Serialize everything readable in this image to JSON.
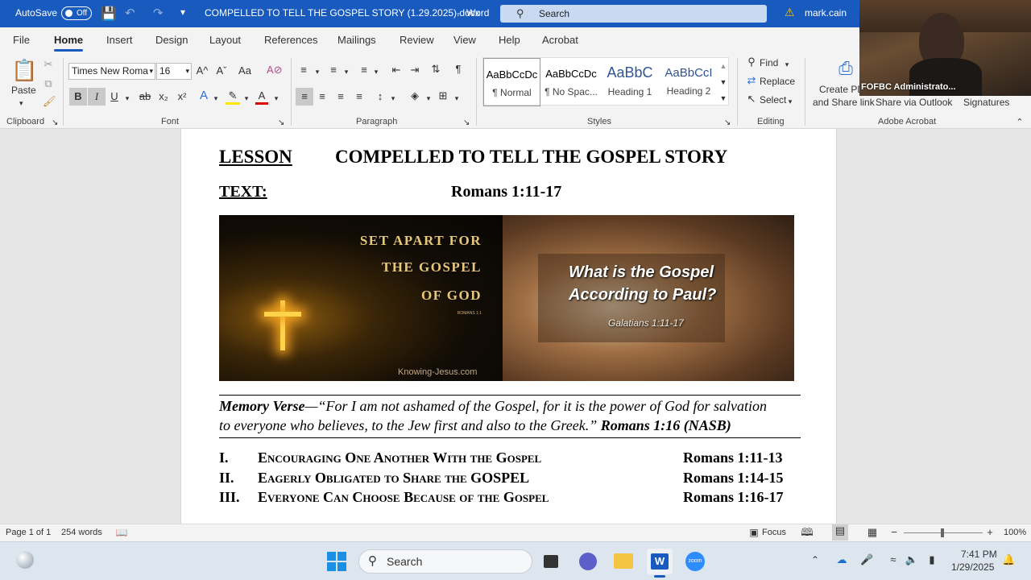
{
  "titlebar": {
    "autosave_label": "AutoSave",
    "autosave_state": "Off",
    "doc_title": "COMPELLED TO TELL THE GOSPEL STORY (1.29.2025).docx",
    "app_sep": "-",
    "app_name": "Word",
    "search_placeholder": "Search",
    "user": "mark.cain"
  },
  "menu": [
    "File",
    "Home",
    "Insert",
    "Design",
    "Layout",
    "References",
    "Mailings",
    "Review",
    "View",
    "Help",
    "Acrobat"
  ],
  "ribbon": {
    "clipboard": {
      "paste": "Paste",
      "label": "Clipboard"
    },
    "font": {
      "name": "Times New Roma",
      "size": "16",
      "label": "Font",
      "grow": "A^",
      "shrink": "Aˇ",
      "case": "Aa",
      "bold": "B",
      "italic": "I",
      "underline": "U",
      "strike": "ab",
      "sub": "x₂",
      "sup": "x²",
      "effects": "A",
      "highlight": "✎",
      "color": "A"
    },
    "paragraph": {
      "label": "Paragraph"
    },
    "styles": {
      "label": "Styles",
      "items": [
        {
          "sample": "AaBbCcDc",
          "name": "¶ Normal"
        },
        {
          "sample": "AaBbCcDc",
          "name": "¶ No Spac..."
        },
        {
          "sample": "AaBbC",
          "name": "Heading 1"
        },
        {
          "sample": "AaBbCcI",
          "name": "Heading 2"
        }
      ]
    },
    "editing": {
      "find": "Find",
      "replace": "Replace",
      "select": "Select",
      "label": "Editing"
    },
    "acrobat": {
      "create_line1": "Create PD",
      "create_line2": "and Share link",
      "share": "Share via Outlook",
      "signatures": "Signatures",
      "label": "Adobe Acrobat"
    }
  },
  "video": {
    "name": "FOFBC Administrato..."
  },
  "doc": {
    "lesson_label": "LESSON",
    "lesson_title": "COMPELLED TO TELL THE GOSPEL STORY",
    "text_label": "TEXT:",
    "text_ref": "Romans 1:11-17",
    "banner": {
      "left_line1": "SET APART FOR",
      "left_line2": "THE GOSPEL",
      "left_line3": "OF GOD",
      "left_small_ref": "ROMANS 1:1",
      "left_site": "Knowing-Jesus.com",
      "right_line1": "What is the Gospel",
      "right_line2": "According to Paul?",
      "right_ref": "Galatians 1:11-17"
    },
    "memory": {
      "label": "Memory Verse",
      "dash": "—",
      "line1": "“For I am not ashamed of the Gospel, for it is the power of God for salvation",
      "line2": "to everyone who believes, to the Jew first and also to the Greek.”",
      "ref": "Romans 1:16 (NASB)"
    },
    "outline": [
      {
        "num": "I.",
        "title": "Encouraging One Another With the Gospel",
        "ref": "Romans 1:11-13"
      },
      {
        "num": "II.",
        "title": "Eagerly Obligated to Share the GOSPEL",
        "ref": "Romans 1:14-15"
      },
      {
        "num": "III.",
        "title": "Everyone Can Choose Because of the Gospel",
        "ref": "Romans 1:16-17"
      }
    ]
  },
  "status": {
    "page": "Page 1 of 1",
    "words": "254 words",
    "focus": "Focus",
    "zoom": "100%"
  },
  "taskbar": {
    "search": "Search",
    "time": "7:41 PM",
    "date": "1/29/2025"
  },
  "colors": {
    "word_blue": "#185abd",
    "ribbon_bg": "#f3f3f3"
  }
}
